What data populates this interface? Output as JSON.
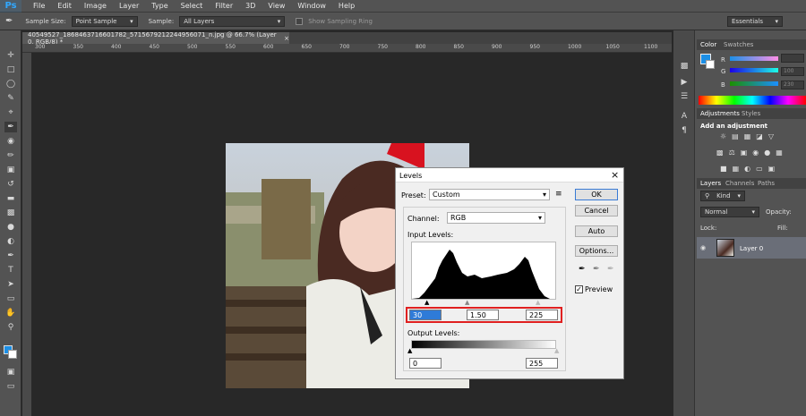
{
  "app": {
    "logo": "Ps"
  },
  "menu": [
    "File",
    "Edit",
    "Image",
    "Layer",
    "Type",
    "Select",
    "Filter",
    "3D",
    "View",
    "Window",
    "Help"
  ],
  "options": {
    "sample_size_label": "Sample Size:",
    "sample_size_value": "Point Sample",
    "sample_label": "Sample:",
    "sample_value": "All Layers",
    "show_ring": "Show Sampling Ring",
    "workspace": "Essentials"
  },
  "document": {
    "tab_title": "40549527_1868463716601782_5715679212244956071_n.jpg @ 66.7% (Layer 0, RGB/8) *"
  },
  "ruler": [
    "300",
    "350",
    "400",
    "450",
    "500",
    "550",
    "600",
    "650",
    "700",
    "750",
    "800",
    "850",
    "900",
    "950",
    "1000",
    "1050",
    "1100"
  ],
  "levels": {
    "title": "Levels",
    "preset_label": "Preset:",
    "preset_value": "Custom",
    "channel_label": "Channel:",
    "channel_value": "RGB",
    "input_label": "Input Levels:",
    "input_black": "30",
    "input_gamma": "1.50",
    "input_white": "225",
    "output_label": "Output Levels:",
    "output_black": "0",
    "output_white": "255",
    "ok": "OK",
    "cancel": "Cancel",
    "auto": "Auto",
    "options": "Options...",
    "preview": "Preview",
    "highlight_color": "#e02020"
  },
  "color_panel": {
    "tabs": [
      "Color",
      "Swatches"
    ],
    "r_label": "R",
    "g_label": "G",
    "b_label": "B",
    "r_value": "",
    "g_value": "100",
    "b_value": "230",
    "fg_color": "#1c8fe6"
  },
  "adjustments": {
    "tabs": [
      "Adjustments",
      "Styles"
    ],
    "heading": "Add an adjustment"
  },
  "layers": {
    "tabs": [
      "Layers",
      "Channels",
      "Paths"
    ],
    "kind": "Kind",
    "blend": "Normal",
    "opacity_label": "Opacity:",
    "lock_label": "Lock:",
    "fill_label": "Fill:",
    "layer_name": "Layer 0"
  }
}
